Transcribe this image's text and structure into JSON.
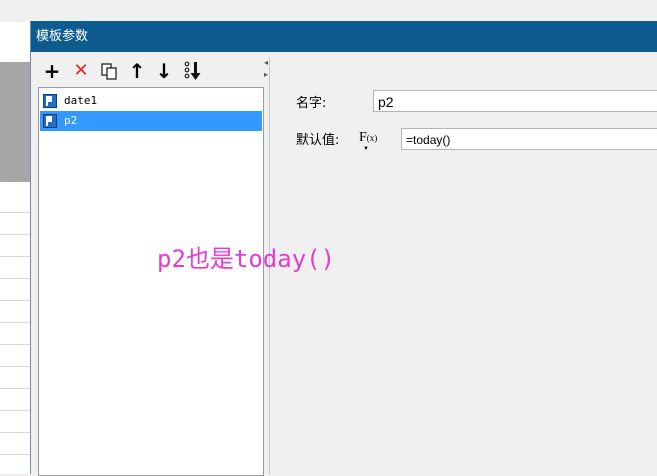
{
  "dialog": {
    "title": "模板参数",
    "titlebar_color": "#0d5b8f"
  },
  "toolbar": {
    "icons": [
      "add-icon",
      "delete-icon",
      "copy-icon",
      "move-up-icon",
      "move-down-icon",
      "sort-icon"
    ],
    "add_glyph": "+",
    "delete_glyph": "✕",
    "up_glyph": "↑",
    "down_glyph": "↓"
  },
  "parameters": [
    {
      "name": "date1",
      "selected": false
    },
    {
      "name": "p2",
      "selected": true
    }
  ],
  "form": {
    "name_label": "名字:",
    "name_value": "p2",
    "default_label": "默认值:",
    "fx_label": "F",
    "fx_sub": "(x)",
    "default_value": "=today()"
  },
  "annotation": {
    "text": "p2也是today()",
    "color": "#e53ad6"
  },
  "colors": {
    "selection": "#3399ff",
    "delete": "#e8232a"
  }
}
